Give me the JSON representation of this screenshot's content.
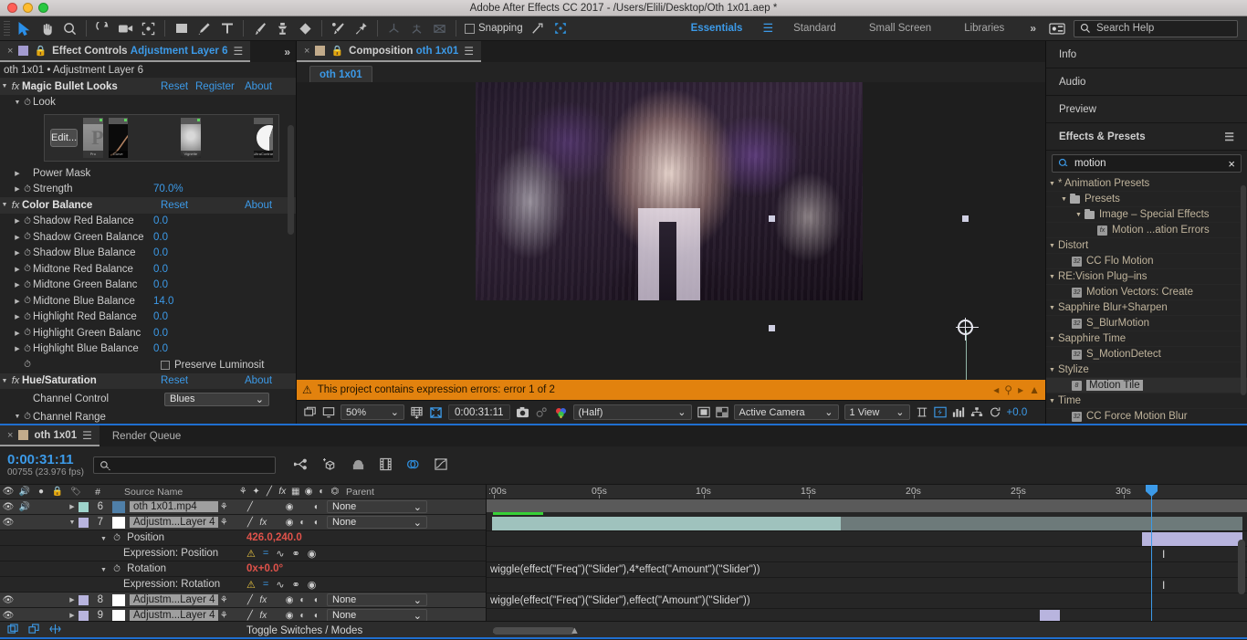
{
  "window": {
    "title": "Adobe After Effects CC 2017 - /Users/Elili/Desktop/Oth 1x01.aep *"
  },
  "toolbar": {
    "snapping_label": "Snapping",
    "workspaces": [
      {
        "label": "Essentials",
        "selected": true
      },
      {
        "label": "Standard",
        "selected": false
      },
      {
        "label": "Small Screen",
        "selected": false
      },
      {
        "label": "Libraries",
        "selected": false
      }
    ],
    "overflow": "»",
    "search_help_placeholder": "Search Help"
  },
  "effect_controls": {
    "tab_prefix": "Effect Controls",
    "tab_layer": "Adjustment Layer 6",
    "close_glyph": "×",
    "breadcrumb": "oth 1x01 • Adjustment Layer 6",
    "effects": [
      {
        "name": "Magic Bullet Looks",
        "links": [
          "Reset",
          "Register",
          "About"
        ],
        "params": [
          {
            "name": "Look",
            "value": "",
            "twirl": "▼",
            "stopwatch": true
          },
          {
            "name": "Power Mask",
            "value": "",
            "twirl": "▶",
            "stopwatch": false
          },
          {
            "name": "Strength",
            "value": "70.0%",
            "twirl": "▶",
            "stopwatch": true
          }
        ],
        "look_edit_label": "Edit...",
        "look_thumbs": [
          "Pro",
          "Curve",
          "Vignette",
          "UltraContrast"
        ]
      },
      {
        "name": "Color Balance",
        "links": [
          "Reset",
          "About"
        ],
        "params": [
          {
            "name": "Shadow Red Balance",
            "value": "0.0",
            "twirl": "▶",
            "stopwatch": true
          },
          {
            "name": "Shadow Green Balance",
            "value": "0.0",
            "twirl": "▶",
            "stopwatch": true
          },
          {
            "name": "Shadow Blue Balance",
            "value": "0.0",
            "twirl": "▶",
            "stopwatch": true
          },
          {
            "name": "Midtone Red Balance",
            "value": "0.0",
            "twirl": "▶",
            "stopwatch": true
          },
          {
            "name": "Midtone Green Balanc",
            "value": "0.0",
            "twirl": "▶",
            "stopwatch": true
          },
          {
            "name": "Midtone Blue Balance",
            "value": "14.0",
            "twirl": "▶",
            "stopwatch": true
          },
          {
            "name": "Highlight Red Balance",
            "value": "0.0",
            "twirl": "▶",
            "stopwatch": true
          },
          {
            "name": "Highlight Green Balanc",
            "value": "0.0",
            "twirl": "▶",
            "stopwatch": true
          },
          {
            "name": "Highlight Blue Balance",
            "value": "0.0",
            "twirl": "▶",
            "stopwatch": true
          }
        ],
        "checkbox_label": "Preserve Luminosit"
      },
      {
        "name": "Hue/Saturation",
        "links": [
          "Reset",
          "About"
        ],
        "params": [
          {
            "name": "Channel Control",
            "value": "Blues",
            "twirl": "",
            "stopwatch": false
          },
          {
            "name": "Channel Range",
            "value": "",
            "twirl": "▼",
            "stopwatch": true
          }
        ]
      }
    ]
  },
  "composition": {
    "tab_prefix": "Composition",
    "tab_name": "oth 1x01",
    "breadcrumb_tab": "oth 1x01",
    "warning": "This project contains expression errors: error 1 of 2",
    "warning_icon": "⚠",
    "bottom_bar": {
      "zoom": "50%",
      "time": "0:00:31:11",
      "resolution": "(Half)",
      "camera": "Active Camera",
      "views": "1 View",
      "exposure": "+0.0"
    }
  },
  "right_panels": {
    "collapsed": [
      "Info",
      "Audio",
      "Preview"
    ],
    "effects_presets_title": "Effects & Presets",
    "search_value": "motion",
    "clear_glyph": "×",
    "tree": [
      {
        "label": "* Animation Presets",
        "indent": 0,
        "type": "group"
      },
      {
        "label": "Presets",
        "indent": 1,
        "type": "folder"
      },
      {
        "label": "Image – Special Effects",
        "indent": 2,
        "type": "folder"
      },
      {
        "label": "Motion ...ation Errors",
        "indent": 3,
        "type": "preset"
      },
      {
        "label": "Distort",
        "indent": 0,
        "type": "group"
      },
      {
        "label": "CC Flo Motion",
        "indent": 1,
        "type": "effect"
      },
      {
        "label": "RE:Vision Plug–ins",
        "indent": 0,
        "type": "group"
      },
      {
        "label": "Motion Vectors: Create",
        "indent": 1,
        "type": "effect"
      },
      {
        "label": "Sapphire Blur+Sharpen",
        "indent": 0,
        "type": "group"
      },
      {
        "label": "S_BlurMotion",
        "indent": 1,
        "type": "effect"
      },
      {
        "label": "Sapphire Time",
        "indent": 0,
        "type": "group"
      },
      {
        "label": "S_MotionDetect",
        "indent": 1,
        "type": "effect"
      },
      {
        "label": "Stylize",
        "indent": 0,
        "type": "group"
      },
      {
        "label": "Motion Tile",
        "indent": 1,
        "type": "effect",
        "selected": true
      },
      {
        "label": "Time",
        "indent": 0,
        "type": "group"
      },
      {
        "label": "CC Force Motion Blur",
        "indent": 1,
        "type": "effect"
      }
    ]
  },
  "timeline": {
    "tab_name": "oth 1x01",
    "tab_render_queue": "Render Queue",
    "current_time": "0:00:31:11",
    "frame_info": "00755 (23.976 fps)",
    "search_placeholder": "",
    "columns": [
      "#",
      "Source Name",
      "Parent"
    ],
    "toggle_switches_label": "Toggle Switches / Modes",
    "ruler_ticks": [
      ":00s",
      "05s",
      "10s",
      "15s",
      "20s",
      "25s",
      "30s"
    ],
    "layers": [
      {
        "index": "6",
        "name": "oth 1x01.mp4",
        "parent": "None",
        "color": "#9fd4cc",
        "twirl": "▶",
        "kind": "footage"
      },
      {
        "index": "7",
        "name": "Adjustm...Layer 4",
        "parent": "None",
        "color": "#b8b4de",
        "twirl": "▼",
        "kind": "solid",
        "properties": [
          {
            "name": "Position",
            "value": "426.0,240.0",
            "twirl": "▼",
            "expression": {
              "label": "Expression: Position",
              "code": "wiggle(effect(\"Freq\")(\"Slider\"),4*effect(\"Amount\")(\"Slider\"))"
            }
          },
          {
            "name": "Rotation",
            "value": "0x+0.0°",
            "twirl": "▼",
            "expression": {
              "label": "Expression: Rotation",
              "code": "wiggle(effect(\"Freq\")(\"Slider\"),effect(\"Amount\")(\"Slider\"))"
            }
          }
        ]
      },
      {
        "index": "8",
        "name": "Adjustm...Layer 4",
        "parent": "None",
        "color": "#b8b4de",
        "twirl": "▶",
        "kind": "solid"
      },
      {
        "index": "9",
        "name": "Adjustm...Layer 4",
        "parent": "None",
        "color": "#b8b4de",
        "twirl": "▶",
        "kind": "solid"
      }
    ]
  }
}
